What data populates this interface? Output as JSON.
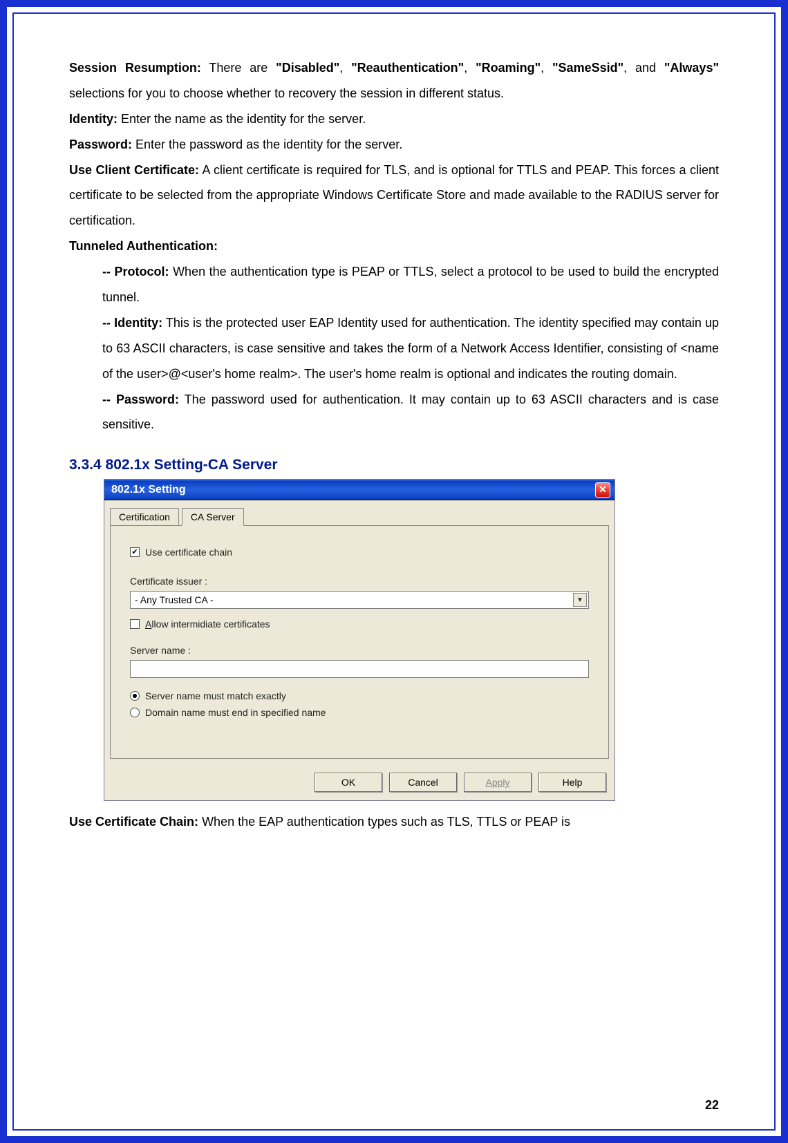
{
  "page_number": "22",
  "para": {
    "p1_label": "Session Resumption:",
    "p1_text_a": " There are ",
    "p1_opt1": "\"Disabled\"",
    "p1_sep1": ", ",
    "p1_opt2": "\"Reauthentication\"",
    "p1_sep2": ", ",
    "p1_opt3": "\"Roaming\"",
    "p1_sep3": ", ",
    "p1_opt4": "\"SameSsid\"",
    "p1_sep4": ", and ",
    "p1_opt5": "\"Always\"",
    "p1_text_b": " selections for you to choose whether to recovery the session in different status.",
    "p2_label": "Identity:",
    "p2_text": " Enter the name as the identity for the server.",
    "p3_label": "Password:",
    "p3_text": " Enter the password as the identity for the server.",
    "p4_label": "Use Client Certificate:",
    "p4_text": " A client certificate is required for TLS, and is optional for TTLS and PEAP. This forces a client certificate to be selected from the appropriate Windows Certificate Store and made available to the RADIUS server for certification.",
    "p5_label": "Tunneled Authentication:",
    "p6_label": "-- Protocol:",
    "p6_text": " When the authentication type is PEAP or TTLS, select a protocol to be used to build the encrypted tunnel.",
    "p7_label": "-- Identity:",
    "p7_text": " This is the protected user EAP Identity used for authentication. The identity specified may contain up to 63 ASCII characters, is case sensitive and takes the form of a Network Access Identifier, consisting of <name of the user>@<user's home realm>. The user's home realm is optional and indicates the routing domain.",
    "p8_label": "-- Password:",
    "p8_text": " The password used for authentication. It may contain up to 63 ASCII characters and is case sensitive."
  },
  "section_heading": "3.3.4 802.1x Setting-CA Server",
  "dialog": {
    "title": "802.1x Setting",
    "tabs": {
      "certification": "Certification",
      "ca_server": "CA Server"
    },
    "use_cert_chain": "Use certificate chain",
    "cert_issuer_label": "Certificate issuer :",
    "cert_issuer_value": "- Any Trusted CA -",
    "allow_intermediate_pre": "A",
    "allow_intermediate_rest": "llow intermidiate certificates",
    "server_name_label": "Server name :",
    "server_name_value": "",
    "radio_exact": "Server name must match exactly",
    "radio_domain": "Domain name must end in specified name",
    "buttons": {
      "ok": "OK",
      "cancel": "Cancel",
      "apply": "Apply",
      "help": "Help"
    }
  },
  "trailing": {
    "label": "Use Certificate Chain:",
    "text": " When the EAP authentication types such as TLS, TTLS or PEAP is"
  }
}
